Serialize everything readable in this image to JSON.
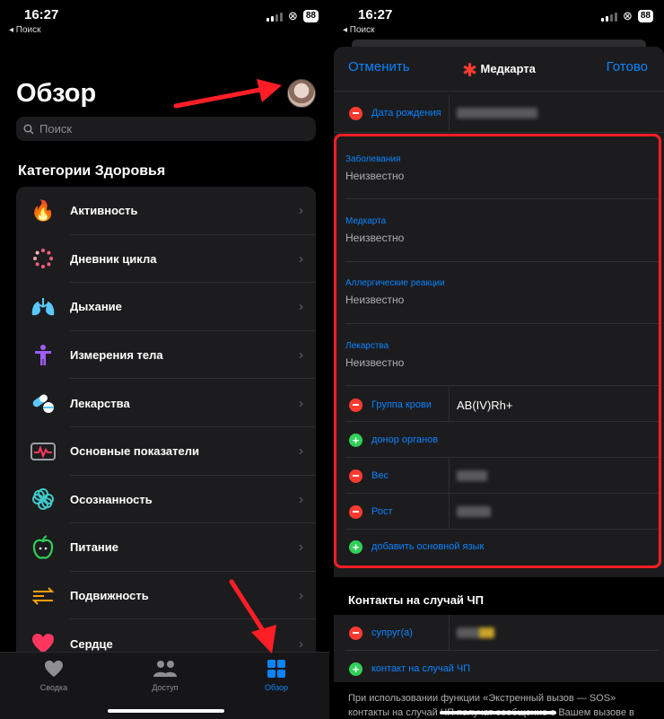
{
  "status": {
    "time": "16:27",
    "back": "◂ Поиск",
    "battery": "88"
  },
  "overview": {
    "title": "Обзор",
    "search_placeholder": "Поиск",
    "section": "Категории Здоровья",
    "categories": [
      {
        "label": "Активность",
        "icon": "flame-icon",
        "color": "#ff6b1a"
      },
      {
        "label": "Дневник цикла",
        "icon": "cycle-dots-icon",
        "color": "#ff5e7e"
      },
      {
        "label": "Дыхание",
        "icon": "lungs-icon",
        "color": "#5ac8fa"
      },
      {
        "label": "Измерения тела",
        "icon": "body-figure-icon",
        "color": "#a05cf7"
      },
      {
        "label": "Лекарства",
        "icon": "pills-icon",
        "color": "#5ac8fa"
      },
      {
        "label": "Основные показатели",
        "icon": "vitals-icon",
        "color": "#ff375f"
      },
      {
        "label": "Осознанность",
        "icon": "mindfulness-icon",
        "color": "#40c8c8"
      },
      {
        "label": "Питание",
        "icon": "apple-icon",
        "color": "#30d158"
      },
      {
        "label": "Подвижность",
        "icon": "mobility-arrows-icon",
        "color": "#ff9f0a"
      },
      {
        "label": "Сердце",
        "icon": "heart-icon",
        "color": "#ff375f"
      }
    ],
    "tabs": [
      {
        "label": "Сводка",
        "icon": "heart-outline-icon"
      },
      {
        "label": "Доступ",
        "icon": "people-icon"
      },
      {
        "label": "Обзор",
        "icon": "grid-icon"
      }
    ]
  },
  "medcard": {
    "cancel": "Отменить",
    "title": "Медкарта",
    "done": "Готово",
    "birth_label": "Дата рождения",
    "fields": [
      {
        "label": "Заболевания",
        "value": "Неизвестно"
      },
      {
        "label": "Медкарта",
        "value": "Неизвестно"
      },
      {
        "label": "Аллергические реакции",
        "value": "Неизвестно"
      },
      {
        "label": "Лекарства",
        "value": "Неизвестно"
      }
    ],
    "blood_label": "Группа крови",
    "blood_value": "AB(IV)Rh+",
    "donor_label": "донор органов",
    "weight_label": "Вес",
    "height_label": "Рост",
    "language_label": "добавить основной язык",
    "contacts_section": "Контакты на случай ЧП",
    "spouse_label": "супруг(а)",
    "add_contact_label": "контакт на случай ЧП",
    "footer": "При использовании функции «Экстренный вызов — SOS» контакты на случай ЧП получат сообщение о Вашем вызове в"
  },
  "colors": {
    "accent": "#0a84ff",
    "highlight": "#ff1e26",
    "remove": "#ff3b30",
    "add": "#30d158"
  }
}
